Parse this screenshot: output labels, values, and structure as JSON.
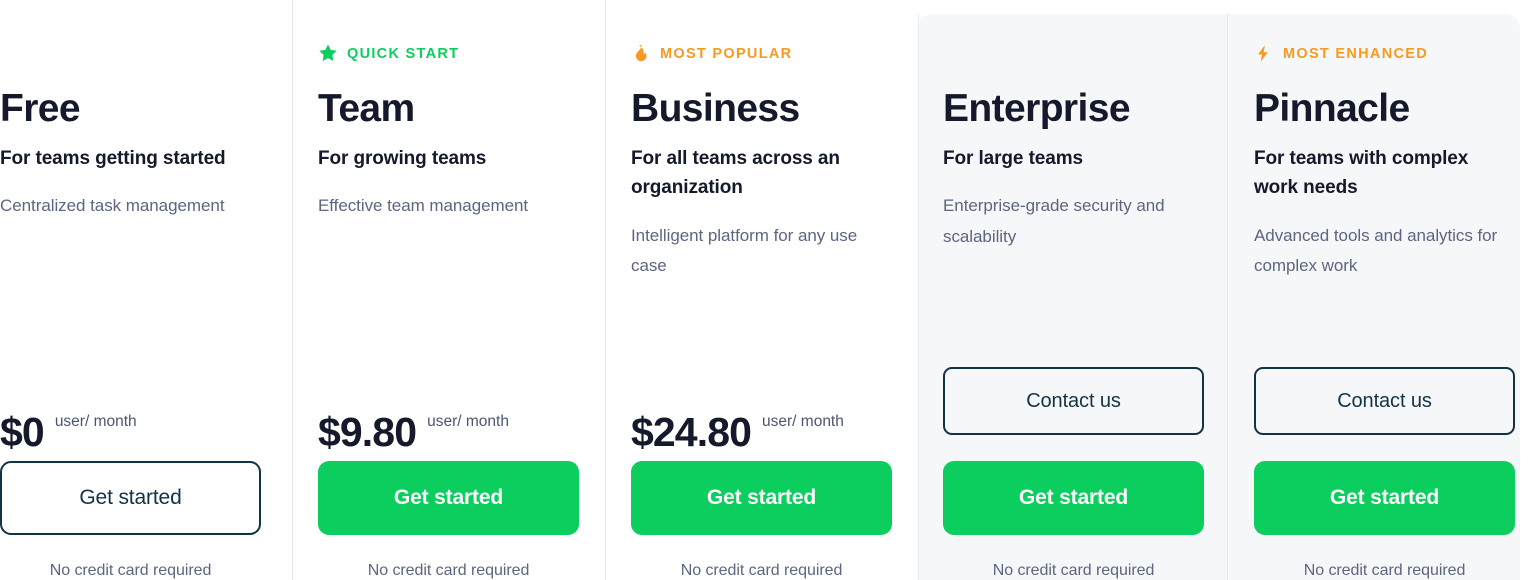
{
  "theme": {
    "brand_green": "#0BCE5F",
    "badge_green": "#0BCE5F",
    "badge_orange": "#F99A20",
    "heading_navy": "#15192C",
    "body_gray": "#5C6581",
    "outline_navy": "#123344",
    "panel_gray": "#F6F7F9",
    "divider": "#E6E9EE"
  },
  "plans": [
    {
      "id": "free",
      "badge": {
        "show": false,
        "label": "",
        "icon": "",
        "color": ""
      },
      "name": "Free",
      "tagline": "For teams getting started",
      "description": "Centralized task management",
      "price": {
        "amount": "$0",
        "period": "user/ month"
      },
      "secondary_button": {
        "show": false,
        "label": ""
      },
      "cta": {
        "label": "Get started",
        "style": "outline"
      },
      "footnote": "No credit card required",
      "highlighted": false
    },
    {
      "id": "team",
      "badge": {
        "show": true,
        "label": "QUICK START",
        "icon": "star-icon",
        "color": "#0BCE5F"
      },
      "name": "Team",
      "tagline": "For growing teams",
      "description": "Effective team management",
      "price": {
        "amount": "$9.80",
        "period": "user/ month"
      },
      "secondary_button": {
        "show": false,
        "label": ""
      },
      "cta": {
        "label": "Get started",
        "style": "primary"
      },
      "footnote": "No credit card required",
      "highlighted": false
    },
    {
      "id": "business",
      "badge": {
        "show": true,
        "label": "MOST POPULAR",
        "icon": "flame-icon",
        "color": "#F99A20"
      },
      "name": "Business",
      "tagline": "For all teams across an organization",
      "description": "Intelligent platform for any use case",
      "price": {
        "amount": "$24.80",
        "period": "user/ month"
      },
      "secondary_button": {
        "show": false,
        "label": ""
      },
      "cta": {
        "label": "Get started",
        "style": "primary"
      },
      "footnote": "No credit card required",
      "highlighted": false
    },
    {
      "id": "enterprise",
      "badge": {
        "show": false,
        "label": "",
        "icon": "",
        "color": ""
      },
      "name": "Enterprise",
      "tagline": "For large teams",
      "description": "Enterprise-grade security and scalability",
      "price": {
        "amount": "",
        "period": ""
      },
      "secondary_button": {
        "show": true,
        "label": "Contact us"
      },
      "cta": {
        "label": "Get started",
        "style": "primary"
      },
      "footnote": "No credit card required",
      "highlighted": true
    },
    {
      "id": "pinnacle",
      "badge": {
        "show": true,
        "label": "MOST ENHANCED",
        "icon": "lightning-icon",
        "color": "#F99A20"
      },
      "name": "Pinnacle",
      "tagline": "For teams with complex work needs",
      "description": "Advanced tools and analytics for complex work",
      "price": {
        "amount": "",
        "period": ""
      },
      "secondary_button": {
        "show": true,
        "label": "Contact us"
      },
      "cta": {
        "label": "Get started",
        "style": "primary"
      },
      "footnote": "No credit card required",
      "highlighted": true
    }
  ]
}
